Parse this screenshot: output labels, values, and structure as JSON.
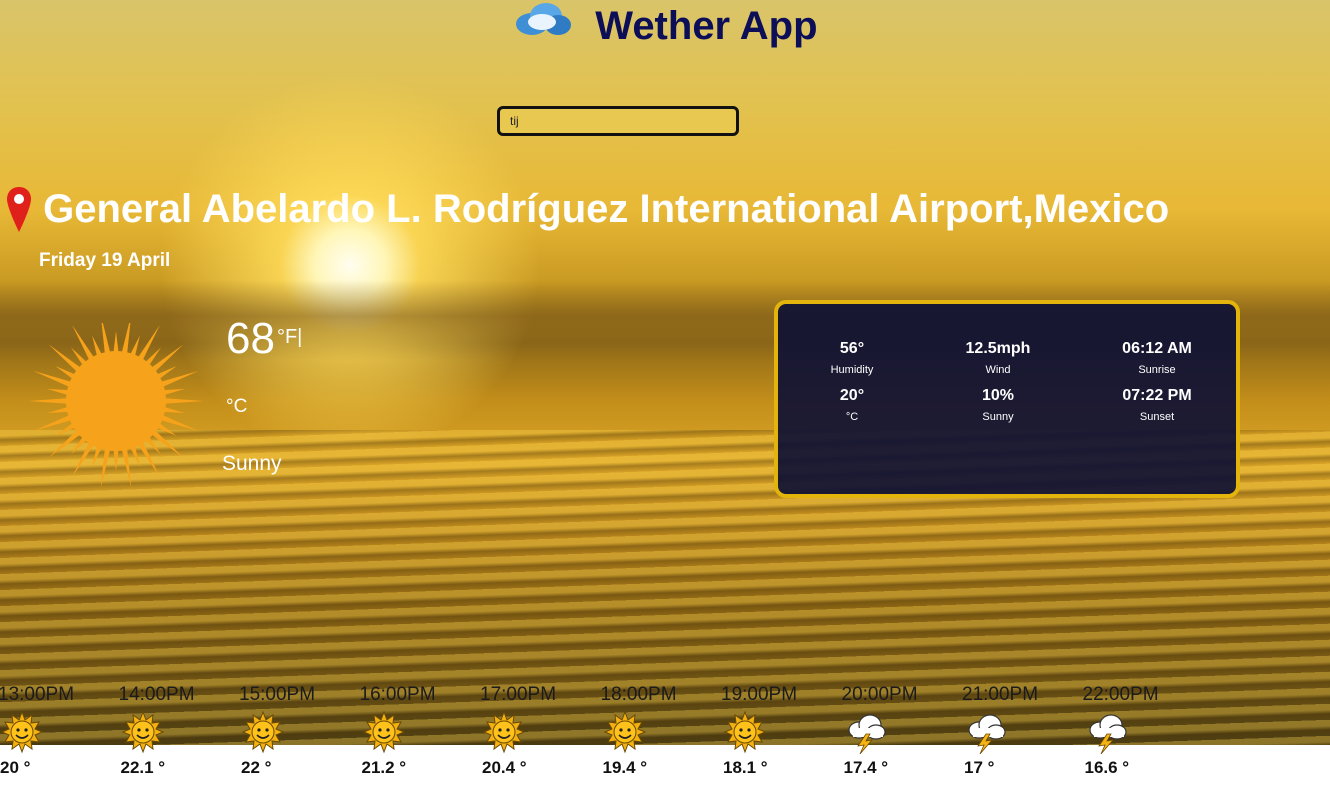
{
  "app": {
    "title": "Wether App",
    "title_icon": "cloud-icon"
  },
  "search": {
    "value": "tij",
    "placeholder": ""
  },
  "location": {
    "name": "General Abelardo L. Rodríguez International Airport,Mexico",
    "icon": "map-pin-icon"
  },
  "date": "Friday 19 April",
  "current": {
    "temperature": "68",
    "unit_toggle": "°F|",
    "unit_c": "°C",
    "condition": "Sunny",
    "icon": "sun-icon"
  },
  "details": [
    {
      "value": "56°",
      "label": "Humidity"
    },
    {
      "value": "12.5mph",
      "label": "Wind"
    },
    {
      "value": "06:12 AM",
      "label": "Sunrise"
    },
    {
      "value": "20°",
      "label": "°C"
    },
    {
      "value": "10%",
      "label": "Sunny"
    },
    {
      "value": "07:22 PM",
      "label": "Sunset"
    }
  ],
  "hourly": [
    {
      "time": "13:00PM",
      "temp": "20 °",
      "icon": "sun-icon"
    },
    {
      "time": "14:00PM",
      "temp": "22.1 °",
      "icon": "sun-icon"
    },
    {
      "time": "15:00PM",
      "temp": "22 °",
      "icon": "sun-icon"
    },
    {
      "time": "16:00PM",
      "temp": "21.2 °",
      "icon": "sun-icon"
    },
    {
      "time": "17:00PM",
      "temp": "20.4 °",
      "icon": "sun-icon"
    },
    {
      "time": "18:00PM",
      "temp": "19.4 °",
      "icon": "sun-icon"
    },
    {
      "time": "19:00PM",
      "temp": "18.1 °",
      "icon": "sun-icon"
    },
    {
      "time": "20:00PM",
      "temp": "17.4 °",
      "icon": "storm-cloud-icon"
    },
    {
      "time": "21:00PM",
      "temp": "17 °",
      "icon": "storm-cloud-icon"
    },
    {
      "time": "22:00PM",
      "temp": "16.6 °",
      "icon": "storm-cloud-icon"
    }
  ],
  "colors": {
    "title": "#0c0f58",
    "panel_border": "#e2b40c",
    "panel_bg": "#0e1034",
    "sun": "#f6a21b"
  }
}
